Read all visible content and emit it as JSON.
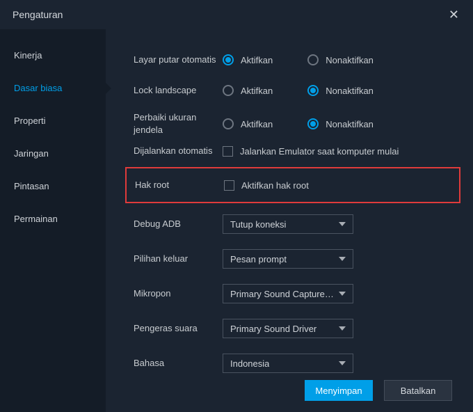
{
  "title": "Pengaturan",
  "sidebar": {
    "items": [
      {
        "label": "Kinerja"
      },
      {
        "label": "Dasar biasa"
      },
      {
        "label": "Properti"
      },
      {
        "label": "Jaringan"
      },
      {
        "label": "Pintasan"
      },
      {
        "label": "Permainan"
      }
    ],
    "activeIndex": 1
  },
  "main": {
    "autoRotate": {
      "label": "Layar putar otomatis",
      "on": "Aktifkan",
      "off": "Nonaktifkan",
      "value": "on"
    },
    "lockLandscape": {
      "label": "Lock landscape",
      "on": "Aktifkan",
      "off": "Nonaktifkan",
      "value": "off"
    },
    "fixWindow": {
      "label": "Perbaiki ukuran jendela",
      "on": "Aktifkan",
      "off": "Nonaktifkan",
      "value": "off"
    },
    "autorun": {
      "label": "Dijalankan otomatis",
      "checkbox": "Jalankan Emulator saat komputer mulai"
    },
    "root": {
      "label": "Hak root",
      "checkbox": "Aktifkan hak root"
    },
    "debugAdb": {
      "label": "Debug ADB",
      "value": "Tutup koneksi"
    },
    "exitOption": {
      "label": "Pilihan keluar",
      "value": "Pesan prompt"
    },
    "microphone": {
      "label": "Mikropon",
      "value": "Primary Sound Capture ..."
    },
    "speaker": {
      "label": "Pengeras suara",
      "value": "Primary Sound Driver"
    },
    "language": {
      "label": "Bahasa",
      "value": "Indonesia"
    }
  },
  "footer": {
    "save": "Menyimpan",
    "cancel": "Batalkan"
  }
}
